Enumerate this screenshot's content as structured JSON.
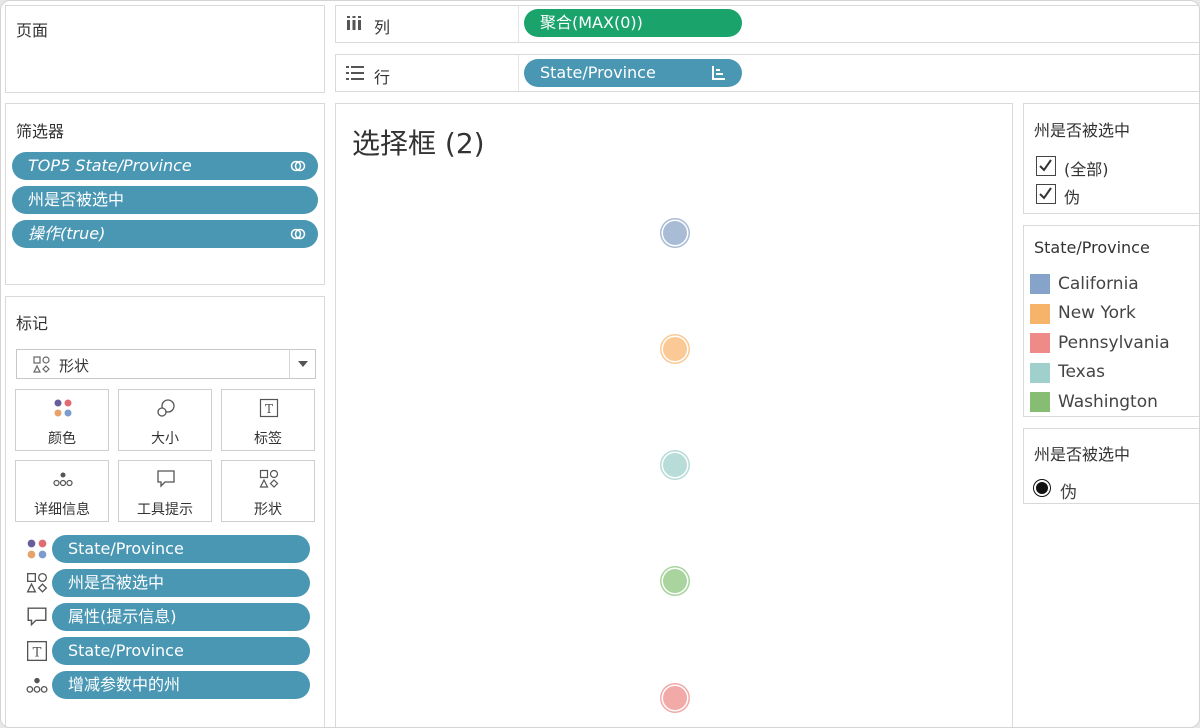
{
  "pages_panel": {
    "title": "页面"
  },
  "shelves": {
    "columns": {
      "label": "列",
      "pill": "聚合(MAX(0))"
    },
    "rows": {
      "label": "行",
      "pill": "State/Province"
    }
  },
  "filters": {
    "title": "筛选器",
    "items": [
      {
        "label": "TOP5 State/Province",
        "italic": true,
        "linked": true
      },
      {
        "label": "州是否被选中",
        "italic": false,
        "linked": false
      },
      {
        "label": "操作(true)",
        "italic": true,
        "linked": true
      }
    ]
  },
  "marks": {
    "title": "标记",
    "mark_type": "形状",
    "buttons": {
      "color": "颜色",
      "size": "大小",
      "label": "标签",
      "detail": "详细信息",
      "tooltip": "工具提示",
      "shape": "形状"
    },
    "encodings": [
      {
        "icon": "color-icon",
        "label": "State/Province"
      },
      {
        "icon": "shape-icon",
        "label": "州是否被选中"
      },
      {
        "icon": "tooltip-icon",
        "label": "属性(提示信息)"
      },
      {
        "icon": "label-icon",
        "label": "State/Province"
      },
      {
        "icon": "detail-icon",
        "label": "增减参数中的州"
      }
    ]
  },
  "view": {
    "title": "选择框 (2)",
    "marks": [
      {
        "state": "California",
        "color": "#a9bcd6"
      },
      {
        "state": "New York",
        "color": "#fac995"
      },
      {
        "state": "Texas",
        "color": "#b8dcd8"
      },
      {
        "state": "Washington",
        "color": "#a9d49e"
      },
      {
        "state": "Pennsylvania",
        "color": "#f2aaa8"
      }
    ]
  },
  "filter_card": {
    "title": "州是否被选中",
    "options": [
      {
        "label": "(全部)",
        "checked": true
      },
      {
        "label": "伪",
        "checked": true
      }
    ]
  },
  "color_legend": {
    "title": "State/Province",
    "items": [
      {
        "label": "California",
        "color": "#86a4c9"
      },
      {
        "label": "New York",
        "color": "#f6b46b"
      },
      {
        "label": "Pennsylvania",
        "color": "#ee8a88"
      },
      {
        "label": "Texas",
        "color": "#9fd0cc"
      },
      {
        "label": "Washington",
        "color": "#86bd73"
      }
    ]
  },
  "shape_legend": {
    "title": "州是否被选中",
    "items": [
      {
        "label": "伪",
        "shape": "filled-circle"
      }
    ]
  }
}
